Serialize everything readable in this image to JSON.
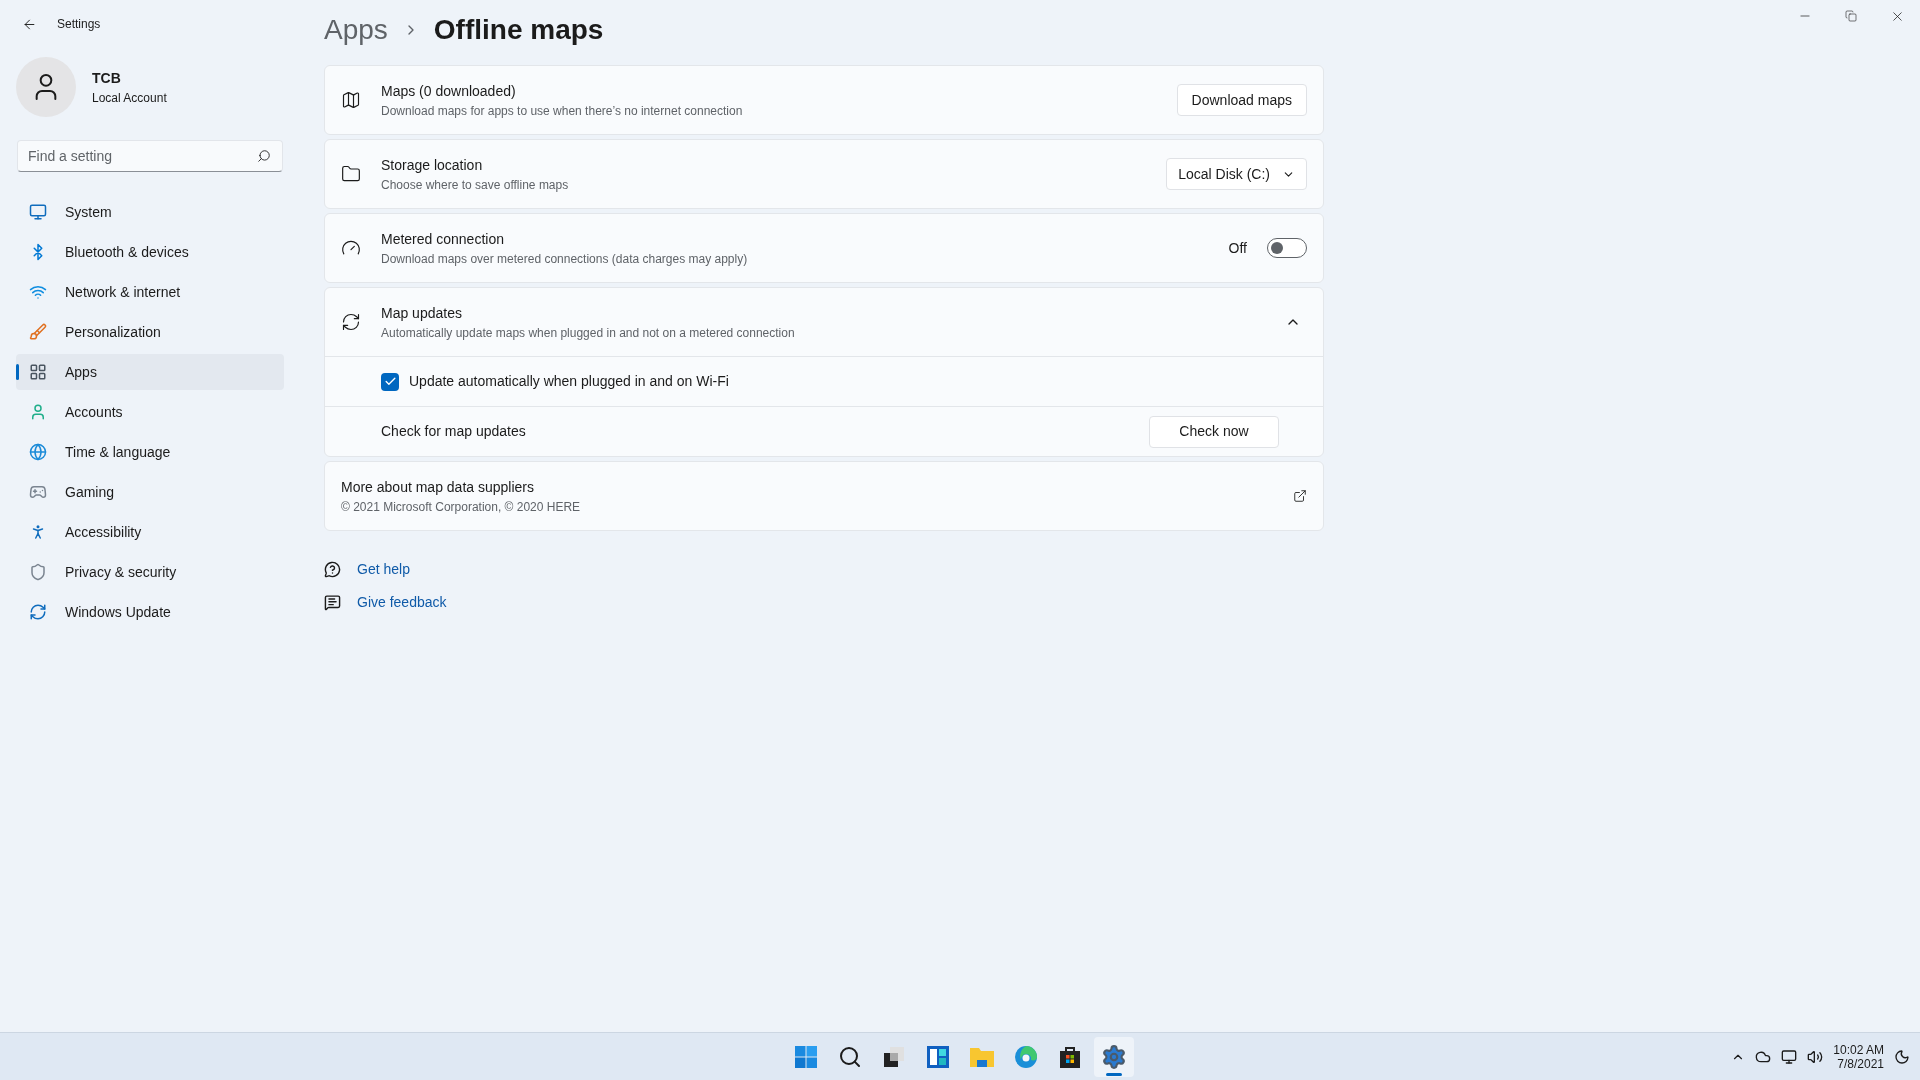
{
  "window": {
    "title": "Settings"
  },
  "account": {
    "name": "TCB",
    "type": "Local Account"
  },
  "search": {
    "placeholder": "Find a setting"
  },
  "nav": [
    {
      "label": "System",
      "selected": false
    },
    {
      "label": "Bluetooth & devices",
      "selected": false
    },
    {
      "label": "Network & internet",
      "selected": false
    },
    {
      "label": "Personalization",
      "selected": false
    },
    {
      "label": "Apps",
      "selected": true
    },
    {
      "label": "Accounts",
      "selected": false
    },
    {
      "label": "Time & language",
      "selected": false
    },
    {
      "label": "Gaming",
      "selected": false
    },
    {
      "label": "Accessibility",
      "selected": false
    },
    {
      "label": "Privacy & security",
      "selected": false
    },
    {
      "label": "Windows Update",
      "selected": false
    }
  ],
  "breadcrumb": {
    "parent": "Apps",
    "current": "Offline maps"
  },
  "cards": [
    {
      "kind": "button",
      "title": "Maps (0 downloaded)",
      "description": "Download maps for apps to use when there’s no internet connection",
      "button": "Download maps"
    },
    {
      "kind": "dropdown",
      "title": "Storage location",
      "description": "Choose where to save offline maps",
      "value": "Local Disk (C:)"
    },
    {
      "kind": "toggle",
      "title": "Metered connection",
      "description": "Download maps over metered connections (data charges may apply)",
      "state_label": "Off",
      "on": false
    },
    {
      "kind": "expander",
      "title": "Map updates",
      "description": "Automatically update maps when plugged in and not on a metered connection",
      "expanded": true,
      "children": [
        {
          "kind": "checkbox",
          "label": "Update automatically when plugged in and on Wi-Fi",
          "checked": true
        },
        {
          "kind": "button",
          "label": "Check for map updates",
          "button": "Check now"
        }
      ]
    },
    {
      "kind": "link",
      "title": "More about map data suppliers",
      "description": "© 2021 Microsoft Corporation, © 2020 HERE"
    }
  ],
  "help_links": [
    {
      "label": "Get help"
    },
    {
      "label": "Give feedback"
    }
  ],
  "taskbar": {
    "apps": [
      {
        "selected": false
      },
      {
        "selected": false
      },
      {
        "selected": false
      },
      {
        "selected": false
      },
      {
        "selected": false
      },
      {
        "selected": false
      },
      {
        "selected": false
      },
      {
        "selected": true
      }
    ],
    "time": "10:02 AM",
    "date": "7/8/2021"
  }
}
